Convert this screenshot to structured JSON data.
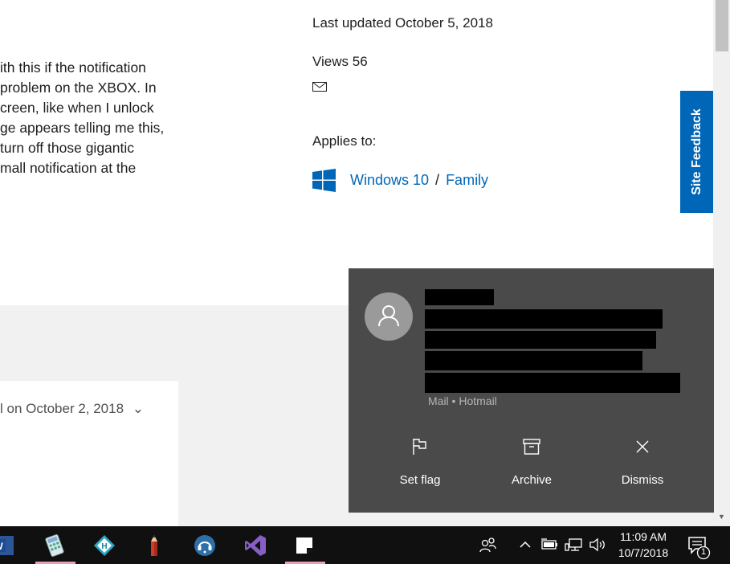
{
  "article": {
    "body_lines": [
      "ith this if the notification",
      "problem on the XBOX. In",
      "creen, like when I unlock",
      "ge appears telling me this,",
      " turn off those gigantic",
      "mall notification at the"
    ],
    "last_updated": "Last updated October 5, 2018",
    "views": "Views 56",
    "applies_to_label": "Applies to:",
    "applies_windows": "Windows 10",
    "applies_sep": "/",
    "applies_family": "Family",
    "replied_on": "l on October 2, 2018",
    "replied_chevron": "⌄"
  },
  "site_feedback": {
    "label": "Site Feedback"
  },
  "notification": {
    "source": "Mail • Hotmail",
    "actions": [
      {
        "label": "Set flag",
        "icon": "flag-icon"
      },
      {
        "label": "Archive",
        "icon": "archive-icon"
      },
      {
        "label": "Dismiss",
        "icon": "close-icon"
      }
    ]
  },
  "taskbar": {
    "time": "11:09 AM",
    "date": "10/7/2018",
    "notification_count": "1",
    "icons": [
      "word-icon",
      "calculator-app-icon",
      "helper-app-icon",
      "pencil-app-icon",
      "headset-app-icon",
      "visual-studio-icon",
      "sticky-notes-icon",
      "people-icon",
      "chevron-up-icon",
      "battery-icon",
      "network-icon",
      "volume-icon",
      "action-center-icon"
    ]
  },
  "colors": {
    "link": "#0067b8",
    "feedback_tab": "#0067b8",
    "toast_bg": "#4a4a4a",
    "taskbar_bg": "#101010",
    "gray_band": "#f1f1f1"
  }
}
